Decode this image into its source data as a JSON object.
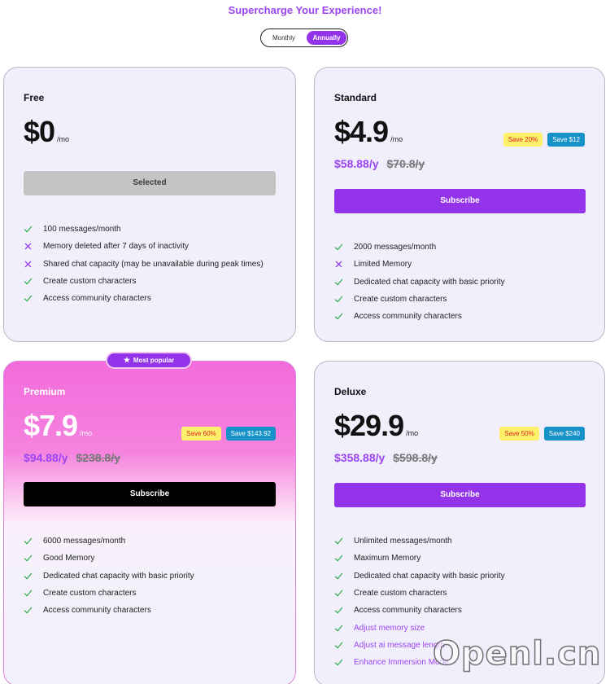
{
  "header": {
    "title": "Supercharge Your Experience!"
  },
  "billing_toggle": {
    "monthly_label": "Monthly",
    "annual_label": "Annually",
    "selected": "Annually"
  },
  "popular_badge": {
    "label": "Most popular",
    "icon": "star-icon"
  },
  "colors": {
    "accent": "#9333ea",
    "check": "#2eaa4a",
    "cross": "#9333ea",
    "save_pct_bg": "#fdf06a",
    "save_amt_bg": "#1792c8"
  },
  "plans": [
    {
      "name": "Free",
      "price": "$0",
      "per": "/mo",
      "button_label": "Selected",
      "features": [
        {
          "icon": "check-icon",
          "text": "100 messages/month"
        },
        {
          "icon": "cross-icon",
          "text": "Memory deleted after 7 days of inactivity"
        },
        {
          "icon": "cross-icon",
          "text": "Shared chat capacity (may be unavailable during peak times)"
        },
        {
          "icon": "check-icon",
          "text": "Create custom characters"
        },
        {
          "icon": "check-icon",
          "text": "Access community characters"
        }
      ]
    },
    {
      "name": "Standard",
      "price": "$4.9",
      "per": "/mo",
      "save_pct": "Save 20%",
      "save_amt": "Save $12",
      "yearly_price": "$58.88/y",
      "yearly_old": "$70.8/y",
      "button_label": "Subscribe",
      "features": [
        {
          "icon": "check-icon",
          "text": "2000 messages/month"
        },
        {
          "icon": "cross-icon",
          "text": "Limited Memory"
        },
        {
          "icon": "check-icon",
          "text": "Dedicated chat capacity with basic priority"
        },
        {
          "icon": "check-icon",
          "text": "Create custom characters"
        },
        {
          "icon": "check-icon",
          "text": "Access community characters"
        }
      ]
    },
    {
      "name": "Premium",
      "price": "$7.9",
      "per": "/mo",
      "save_pct": "Save 60%",
      "save_amt": "Save $143.92",
      "yearly_price": "$94.88/y",
      "yearly_old": "$238.8/y",
      "button_label": "Subscribe",
      "features": [
        {
          "icon": "check-icon",
          "text": "6000 messages/month"
        },
        {
          "icon": "check-icon",
          "text": "Good Memory"
        },
        {
          "icon": "check-icon",
          "text": "Dedicated chat capacity with basic priority"
        },
        {
          "icon": "check-icon",
          "text": "Create custom characters"
        },
        {
          "icon": "check-icon",
          "text": "Access community characters"
        }
      ]
    },
    {
      "name": "Deluxe",
      "price": "$29.9",
      "per": "/mo",
      "save_pct": "Save 50%",
      "save_amt": "Save $240",
      "yearly_price": "$358.88/y",
      "yearly_old": "$598.8/y",
      "button_label": "Subscribe",
      "features": [
        {
          "icon": "check-icon",
          "text": "Unlimited messages/month"
        },
        {
          "icon": "check-icon",
          "text": "Maximum Memory"
        },
        {
          "icon": "check-icon",
          "text": "Dedicated chat capacity with basic priority"
        },
        {
          "icon": "check-icon",
          "text": "Create custom characters"
        },
        {
          "icon": "check-icon",
          "text": "Access community characters"
        },
        {
          "icon": "check-icon",
          "text": "Adjust memory size",
          "extra": true
        },
        {
          "icon": "check-icon",
          "text": "Adjust ai message length",
          "extra": true
        },
        {
          "icon": "check-icon",
          "text": "Enhance Immersion Mode",
          "extra": true
        }
      ]
    }
  ],
  "watermark": {
    "text": "Openl.cn"
  }
}
